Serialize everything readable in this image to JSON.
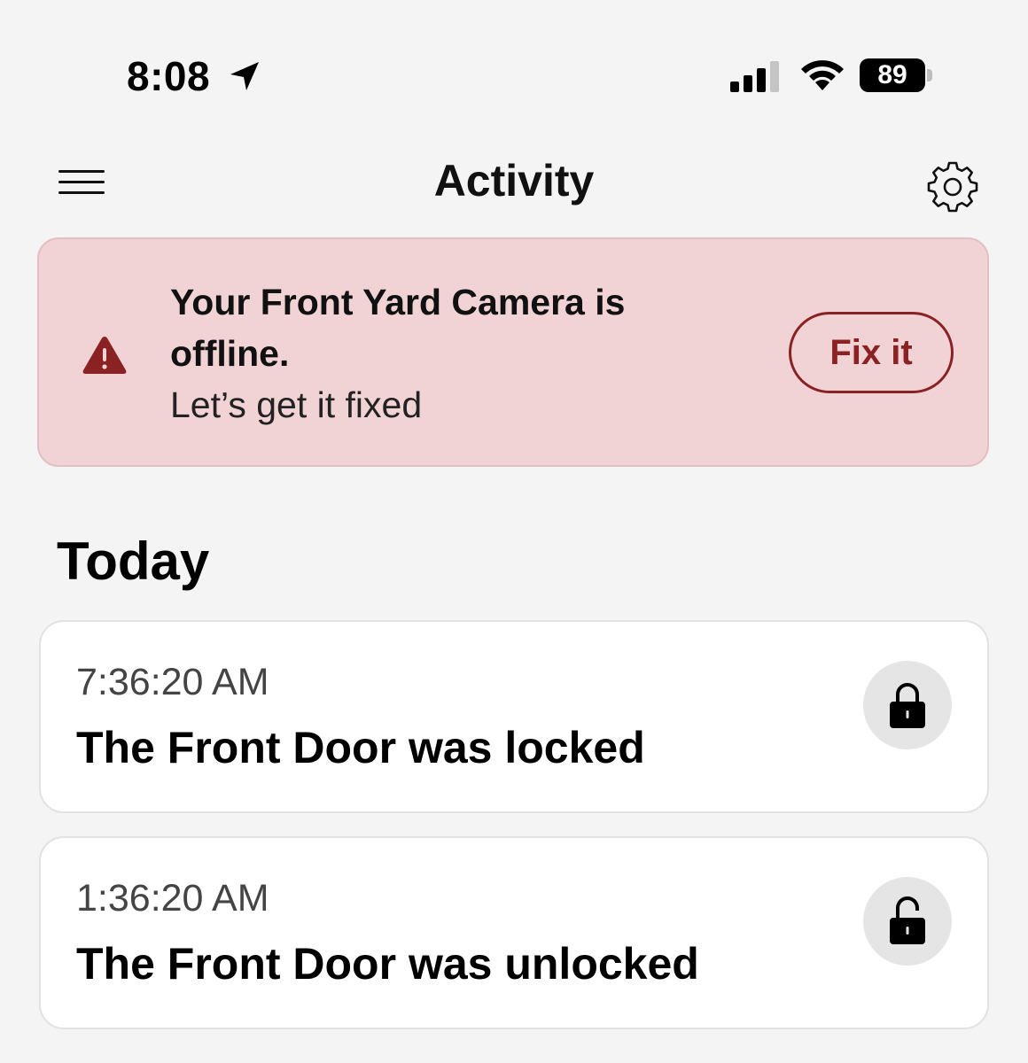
{
  "status_bar": {
    "time": "8:08",
    "battery": "89",
    "icons": [
      "location-arrow-icon",
      "cellular-signal-icon",
      "wifi-icon",
      "battery-icon"
    ]
  },
  "header": {
    "title": "Activity",
    "menu_icon": "hamburger-menu-icon",
    "settings_icon": "gear-icon"
  },
  "alert": {
    "icon": "warning-triangle-icon",
    "title": "Your Front Yard Camera is offline.",
    "subtitle": "Let’s get it fixed",
    "button_label": "Fix it",
    "colors": {
      "background": "#f1d3d6",
      "accent": "#8a2223"
    }
  },
  "activity": {
    "section_title": "Today",
    "events": [
      {
        "time": "7:36:20 AM",
        "message": "The Front Door was locked",
        "icon": "padlock-locked-icon"
      },
      {
        "time": "1:36:20 AM",
        "message": "The Front Door was unlocked",
        "icon": "padlock-unlocked-icon"
      }
    ]
  }
}
